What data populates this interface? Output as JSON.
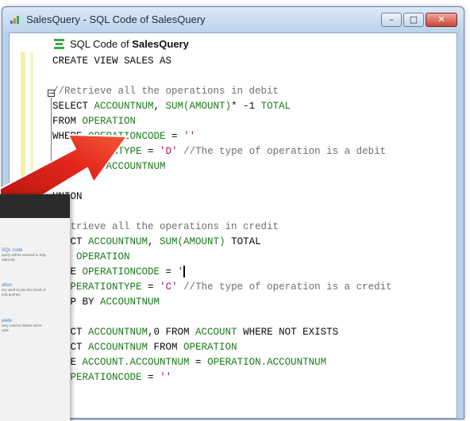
{
  "window": {
    "title": "SalesQuery - SQL Code of SalesQuery",
    "buttons": {
      "minimize": "–",
      "maximize": "□",
      "close": "✕"
    }
  },
  "header": {
    "icon": "sql-document-icon",
    "label_prefix": "SQL Code of ",
    "label_name": "SalesQuery"
  },
  "code": {
    "lines": [
      [
        {
          "t": "CREATE VIEW SALES AS",
          "c": "kw"
        }
      ],
      [],
      [
        {
          "t": "//Retrieve all the operations in debit",
          "c": "cm"
        }
      ],
      [
        {
          "t": "SELECT ",
          "c": "kw"
        },
        {
          "t": "ACCOUNTNUM",
          "c": "fn"
        },
        {
          "t": ", ",
          "c": "kw"
        },
        {
          "t": "SUM(AMOUNT)",
          "c": "fn"
        },
        {
          "t": "* -1 ",
          "c": "kw"
        },
        {
          "t": "TOTAL",
          "c": "fn"
        }
      ],
      [
        {
          "t": "FROM ",
          "c": "kw"
        },
        {
          "t": "OPERATION",
          "c": "fn"
        }
      ],
      [
        {
          "t": "WHERE ",
          "c": "kw"
        },
        {
          "t": "OPERATIONCODE",
          "c": "fn"
        },
        {
          "t": " = ",
          "c": "kw"
        },
        {
          "t": "''",
          "c": "st"
        }
      ],
      [
        {
          "t": "   ",
          "c": "kw"
        },
        {
          "t": "      ONTYPE",
          "c": "fn"
        },
        {
          "t": " = ",
          "c": "kw"
        },
        {
          "t": "'D'",
          "c": "st"
        },
        {
          "t": " //The type of operation is a debit",
          "c": "cm"
        }
      ],
      [
        {
          "t": "        ",
          "c": "kw"
        },
        {
          "t": " ACCOUNTNUM",
          "c": "fn"
        }
      ],
      [],
      [
        {
          "t": "UNION",
          "c": "kw"
        }
      ],
      [],
      [
        {
          "t": "  etrieve all the operations in credit",
          "c": "cm"
        }
      ],
      [
        {
          "t": "  ECT ",
          "c": "kw"
        },
        {
          "t": "ACCOUNTNUM",
          "c": "fn"
        },
        {
          "t": ", ",
          "c": "kw"
        },
        {
          "t": "SUM(AMOUNT)",
          "c": "fn"
        },
        {
          "t": " TOTAL",
          "c": "kw"
        }
      ],
      [
        {
          "t": "  M ",
          "c": "kw"
        },
        {
          "t": "OPERATION",
          "c": "fn"
        }
      ],
      [
        {
          "t": "  RE ",
          "c": "kw"
        },
        {
          "t": "OPERATIONCODE",
          "c": "fn"
        },
        {
          "t": " = ",
          "c": "kw"
        },
        {
          "t": "'",
          "c": "st"
        },
        {
          "t": "CARET",
          "c": "caret"
        }
      ],
      [
        {
          "t": "  ",
          "c": "kw"
        },
        {
          "t": "OPERATIONTYPE",
          "c": "fn"
        },
        {
          "t": " = ",
          "c": "kw"
        },
        {
          "t": "'C'",
          "c": "st"
        },
        {
          "t": " //The type of operation is a credit",
          "c": "cm"
        }
      ],
      [
        {
          "t": "  UP BY ",
          "c": "kw"
        },
        {
          "t": "ACCOUNTNUM",
          "c": "fn"
        }
      ],
      [],
      [
        {
          "t": "  ECT ",
          "c": "kw"
        },
        {
          "t": "ACCOUNTNUM",
          "c": "fn"
        },
        {
          "t": ",0 FROM ",
          "c": "kw"
        },
        {
          "t": "ACCOUNT",
          "c": "fn"
        },
        {
          "t": " WHERE NOT EXISTS",
          "c": "kw"
        }
      ],
      [
        {
          "t": "  ECT ",
          "c": "kw"
        },
        {
          "t": "ACCOUNTNUM",
          "c": "fn"
        },
        {
          "t": " FROM ",
          "c": "kw"
        },
        {
          "t": "OPERATION",
          "c": "fn"
        }
      ],
      [
        {
          "t": "  RE ",
          "c": "kw"
        },
        {
          "t": "ACCOUNT.ACCOUNTNUM",
          "c": "fn"
        },
        {
          "t": " = ",
          "c": "kw"
        },
        {
          "t": "OPERATION.ACCOUNTNUM",
          "c": "fn"
        }
      ],
      [
        {
          "t": "  ",
          "c": "kw"
        },
        {
          "t": "OPERATIONCODE",
          "c": "fn"
        },
        {
          "t": " = ",
          "c": "kw"
        },
        {
          "t": "''",
          "c": "st"
        }
      ]
    ]
  },
  "overlay": {
    "items": [
      {
        "title": "SQL code",
        "desc": "query will be entered in SQL\nedirectly"
      },
      {
        "title": "ation",
        "desc": "ery used to join the result of\neral queries"
      },
      {
        "title": "elete",
        "desc": "uery used to delete some\nords"
      }
    ]
  },
  "colors": {
    "arrow": "#e3261b",
    "keyword": "#0a0a0a",
    "field": "#1a7a1a",
    "comment": "#6f6f6f",
    "string": "#b0106a",
    "titlebar": "#c7dbf0"
  }
}
